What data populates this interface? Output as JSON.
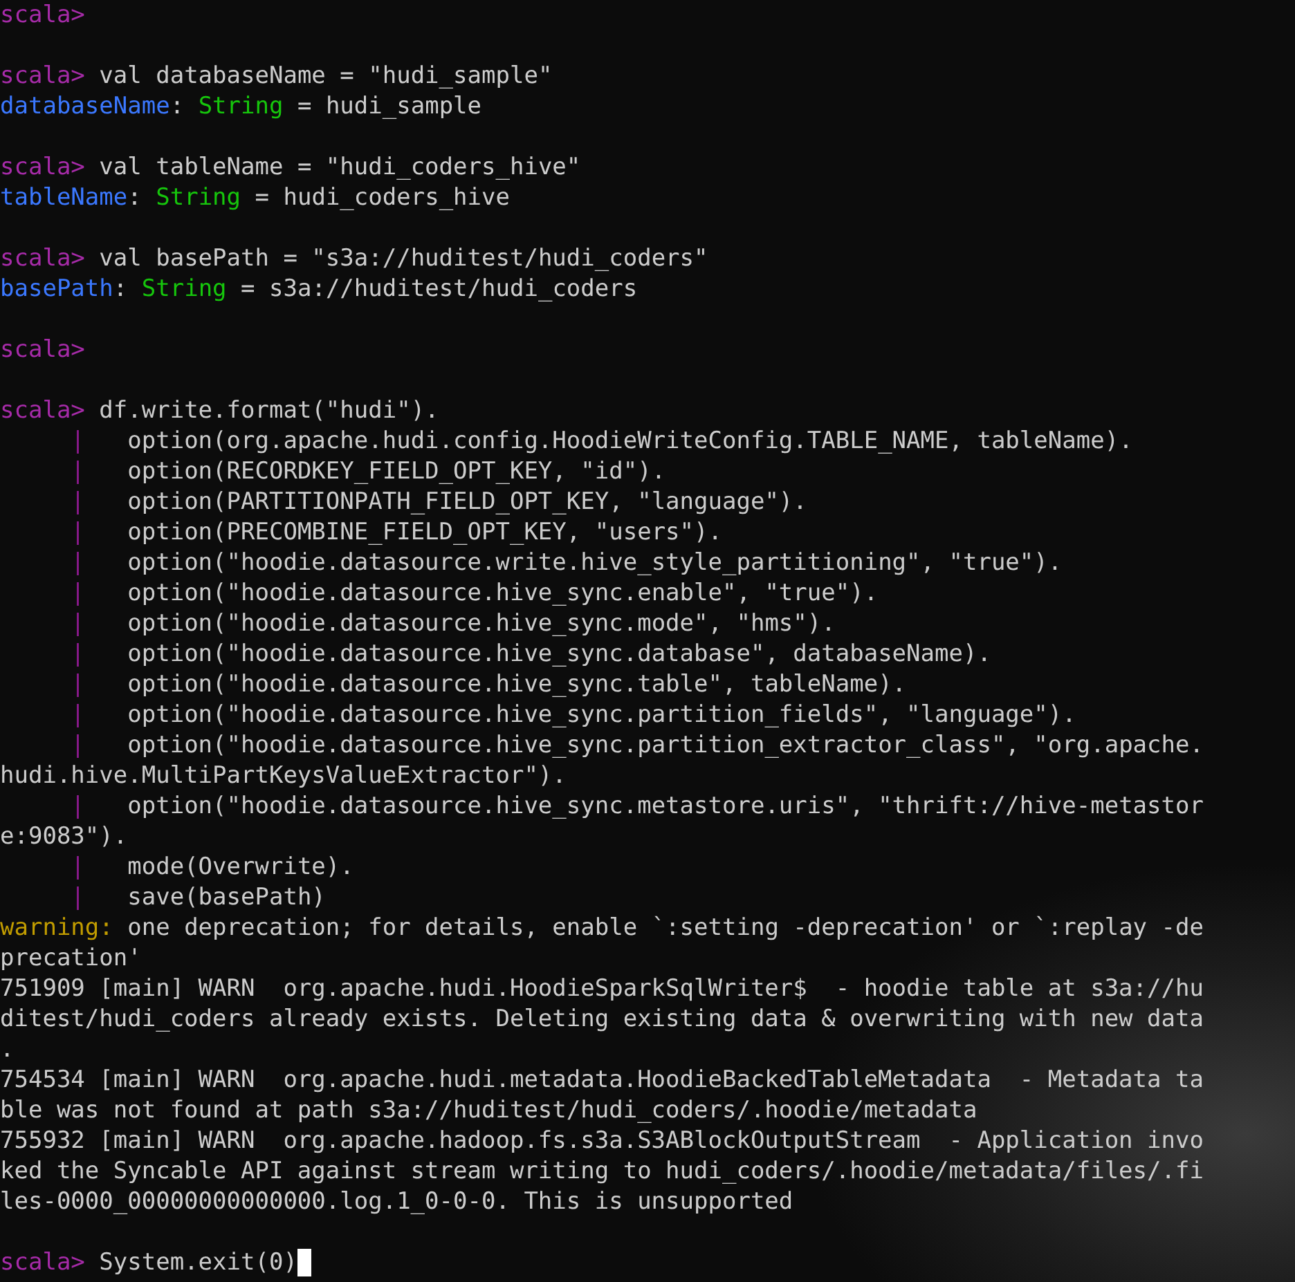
{
  "terminal": {
    "lines": [
      {
        "kind": "text",
        "segments": [
          {
            "kind": "prompt",
            "text": "scala>"
          }
        ]
      },
      {
        "kind": "blank"
      },
      {
        "kind": "text",
        "segments": [
          {
            "kind": "prompt",
            "text": "scala>"
          },
          {
            "kind": "plain",
            "text": " val databaseName = \"hudi_sample\""
          }
        ]
      },
      {
        "kind": "text",
        "segments": [
          {
            "kind": "name",
            "text": "databaseName"
          },
          {
            "kind": "plain",
            "text": ": "
          },
          {
            "kind": "type",
            "text": "String"
          },
          {
            "kind": "plain",
            "text": " = hudi_sample"
          }
        ]
      },
      {
        "kind": "blank"
      },
      {
        "kind": "text",
        "segments": [
          {
            "kind": "prompt",
            "text": "scala>"
          },
          {
            "kind": "plain",
            "text": " val tableName = \"hudi_coders_hive\""
          }
        ]
      },
      {
        "kind": "text",
        "segments": [
          {
            "kind": "name",
            "text": "tableName"
          },
          {
            "kind": "plain",
            "text": ": "
          },
          {
            "kind": "type",
            "text": "String"
          },
          {
            "kind": "plain",
            "text": " = hudi_coders_hive"
          }
        ]
      },
      {
        "kind": "blank"
      },
      {
        "kind": "text",
        "segments": [
          {
            "kind": "prompt",
            "text": "scala>"
          },
          {
            "kind": "plain",
            "text": " val basePath = \"s3a://huditest/hudi_coders\""
          }
        ]
      },
      {
        "kind": "text",
        "segments": [
          {
            "kind": "name",
            "text": "basePath"
          },
          {
            "kind": "plain",
            "text": ": "
          },
          {
            "kind": "type",
            "text": "String"
          },
          {
            "kind": "plain",
            "text": " = s3a://huditest/hudi_coders"
          }
        ]
      },
      {
        "kind": "blank"
      },
      {
        "kind": "text",
        "segments": [
          {
            "kind": "prompt",
            "text": "scala>"
          }
        ]
      },
      {
        "kind": "blank"
      },
      {
        "kind": "text",
        "segments": [
          {
            "kind": "prompt",
            "text": "scala>"
          },
          {
            "kind": "plain",
            "text": " df.write.format(\"hudi\")."
          }
        ]
      },
      {
        "kind": "continuation",
        "segments": [
          {
            "kind": "pipe",
            "text": "|"
          },
          {
            "kind": "plain",
            "text": "option(org.apache.hudi.config.HoodieWriteConfig.TABLE_NAME, tableName)."
          }
        ]
      },
      {
        "kind": "continuation",
        "segments": [
          {
            "kind": "pipe",
            "text": "|"
          },
          {
            "kind": "plain",
            "text": "option(RECORDKEY_FIELD_OPT_KEY, \"id\")."
          }
        ]
      },
      {
        "kind": "continuation",
        "segments": [
          {
            "kind": "pipe",
            "text": "|"
          },
          {
            "kind": "plain",
            "text": "option(PARTITIONPATH_FIELD_OPT_KEY, \"language\")."
          }
        ]
      },
      {
        "kind": "continuation",
        "segments": [
          {
            "kind": "pipe",
            "text": "|"
          },
          {
            "kind": "plain",
            "text": "option(PRECOMBINE_FIELD_OPT_KEY, \"users\")."
          }
        ]
      },
      {
        "kind": "continuation",
        "segments": [
          {
            "kind": "pipe",
            "text": "|"
          },
          {
            "kind": "plain",
            "text": "option(\"hoodie.datasource.write.hive_style_partitioning\", \"true\")."
          }
        ]
      },
      {
        "kind": "continuation",
        "segments": [
          {
            "kind": "pipe",
            "text": "|"
          },
          {
            "kind": "plain",
            "text": "option(\"hoodie.datasource.hive_sync.enable\", \"true\")."
          }
        ]
      },
      {
        "kind": "continuation",
        "segments": [
          {
            "kind": "pipe",
            "text": "|"
          },
          {
            "kind": "plain",
            "text": "option(\"hoodie.datasource.hive_sync.mode\", \"hms\")."
          }
        ]
      },
      {
        "kind": "continuation",
        "segments": [
          {
            "kind": "pipe",
            "text": "|"
          },
          {
            "kind": "plain",
            "text": "option(\"hoodie.datasource.hive_sync.database\", databaseName)."
          }
        ]
      },
      {
        "kind": "continuation",
        "segments": [
          {
            "kind": "pipe",
            "text": "|"
          },
          {
            "kind": "plain",
            "text": "option(\"hoodie.datasource.hive_sync.table\", tableName)."
          }
        ]
      },
      {
        "kind": "continuation",
        "segments": [
          {
            "kind": "pipe",
            "text": "|"
          },
          {
            "kind": "plain",
            "text": "option(\"hoodie.datasource.hive_sync.partition_fields\", \"language\")."
          }
        ]
      },
      {
        "kind": "continuation",
        "segments": [
          {
            "kind": "pipe",
            "text": "|"
          },
          {
            "kind": "plain",
            "text": "option(\"hoodie.datasource.hive_sync.partition_extractor_class\", \"org.apache."
          }
        ]
      },
      {
        "kind": "text",
        "segments": [
          {
            "kind": "plain",
            "text": "hudi.hive.MultiPartKeysValueExtractor\")."
          }
        ]
      },
      {
        "kind": "continuation",
        "segments": [
          {
            "kind": "pipe",
            "text": "|"
          },
          {
            "kind": "plain",
            "text": "option(\"hoodie.datasource.hive_sync.metastore.uris\", \"thrift://hive-metastor"
          }
        ]
      },
      {
        "kind": "text",
        "segments": [
          {
            "kind": "plain",
            "text": "e:9083\")."
          }
        ]
      },
      {
        "kind": "continuation",
        "segments": [
          {
            "kind": "pipe",
            "text": "|"
          },
          {
            "kind": "plain",
            "text": "mode(Overwrite)."
          }
        ]
      },
      {
        "kind": "continuation",
        "segments": [
          {
            "kind": "pipe",
            "text": "|"
          },
          {
            "kind": "plain",
            "text": "save(basePath)"
          }
        ]
      },
      {
        "kind": "text",
        "segments": [
          {
            "kind": "warning",
            "text": "warning:"
          },
          {
            "kind": "plain",
            "text": " one deprecation; for details, enable `:setting -deprecation' or `:replay -de"
          }
        ]
      },
      {
        "kind": "text",
        "segments": [
          {
            "kind": "plain",
            "text": "precation'"
          }
        ]
      },
      {
        "kind": "text",
        "segments": [
          {
            "kind": "plain",
            "text": "751909 [main] WARN  org.apache.hudi.HoodieSparkSqlWriter$  - hoodie table at s3a://hu"
          }
        ]
      },
      {
        "kind": "text",
        "segments": [
          {
            "kind": "plain",
            "text": "ditest/hudi_coders already exists. Deleting existing data & overwriting with new data"
          }
        ]
      },
      {
        "kind": "text",
        "segments": [
          {
            "kind": "plain",
            "text": "."
          }
        ]
      },
      {
        "kind": "text",
        "segments": [
          {
            "kind": "plain",
            "text": "754534 [main] WARN  org.apache.hudi.metadata.HoodieBackedTableMetadata  - Metadata ta"
          }
        ]
      },
      {
        "kind": "text",
        "segments": [
          {
            "kind": "plain",
            "text": "ble was not found at path s3a://huditest/hudi_coders/.hoodie/metadata"
          }
        ]
      },
      {
        "kind": "text",
        "segments": [
          {
            "kind": "plain",
            "text": "755932 [main] WARN  org.apache.hadoop.fs.s3a.S3ABlockOutputStream  - Application invo"
          }
        ]
      },
      {
        "kind": "text",
        "segments": [
          {
            "kind": "plain",
            "text": "ked the Syncable API against stream writing to hudi_coders/.hoodie/metadata/files/.fi"
          }
        ]
      },
      {
        "kind": "text",
        "segments": [
          {
            "kind": "plain",
            "text": "les-0000_00000000000000.log.1_0-0-0. This is unsupported"
          }
        ]
      },
      {
        "kind": "blank"
      },
      {
        "kind": "text",
        "cursor": true,
        "segments": [
          {
            "kind": "prompt",
            "text": "scala>"
          },
          {
            "kind": "plain",
            "text": " System.exit(0)"
          }
        ]
      }
    ]
  }
}
